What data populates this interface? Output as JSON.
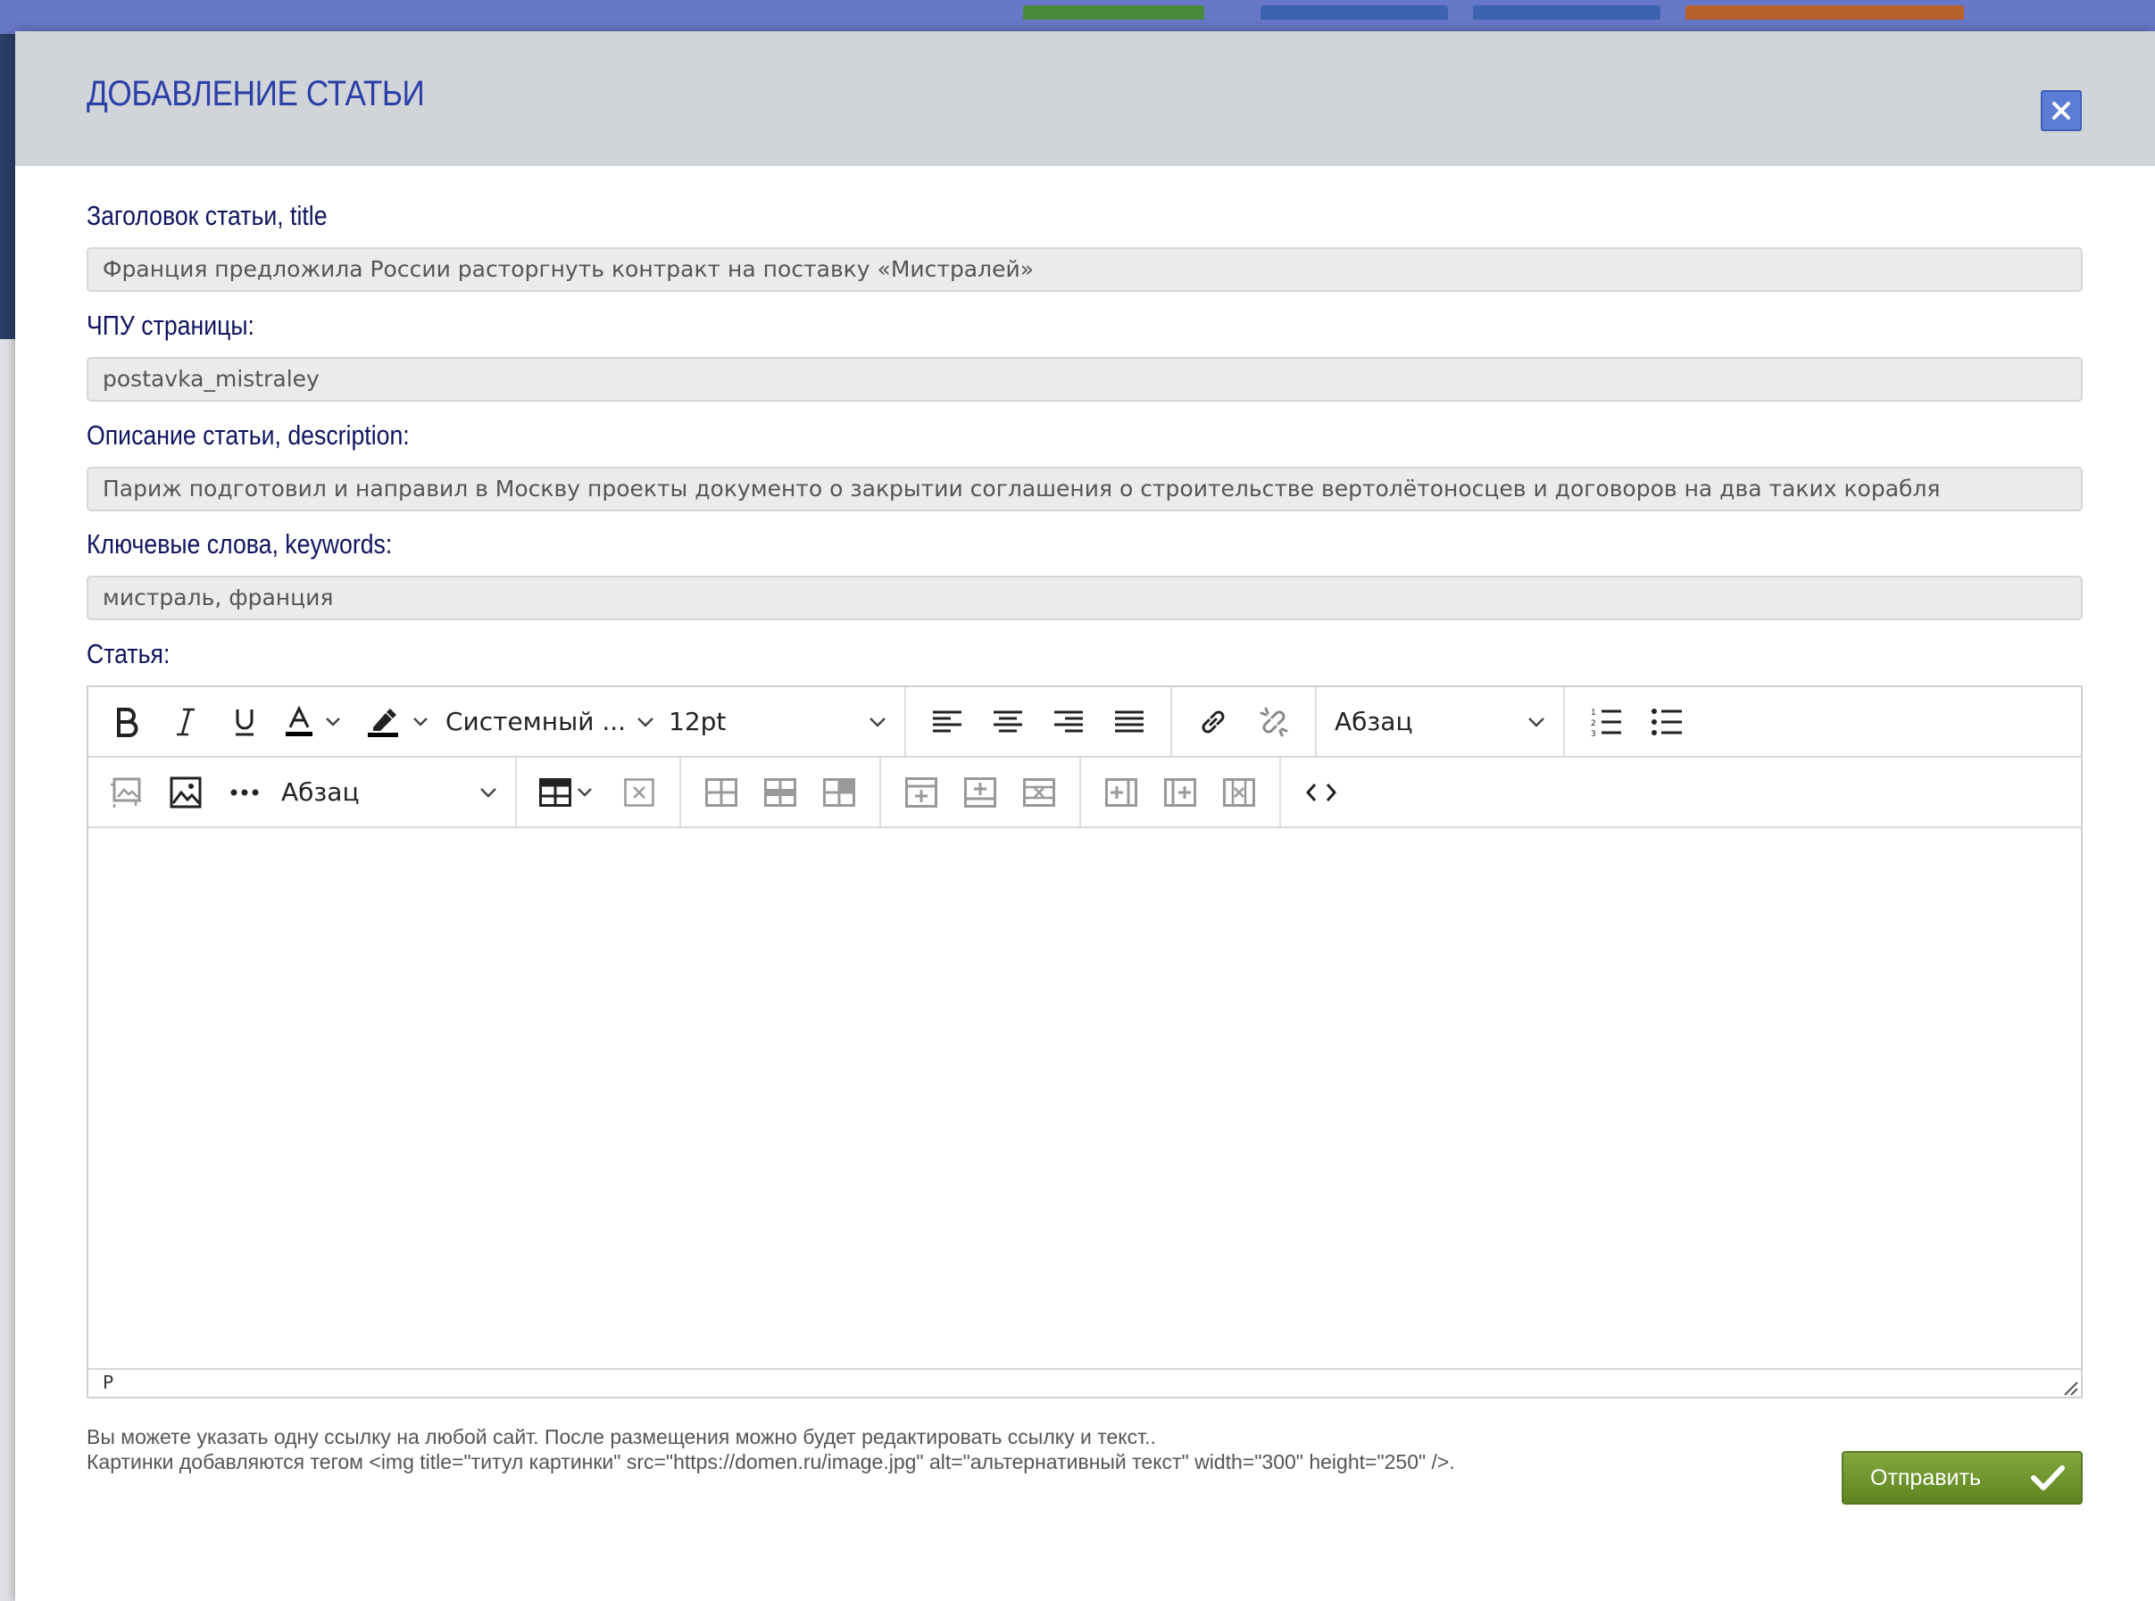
{
  "modal": {
    "title": "ДОБАВЛЕНИЕ СТАТЬИ"
  },
  "form": {
    "title_label": "Заголовок статьи, title",
    "title_value": "Франция предложила России расторгнуть контракт на поставку «Мистралей»",
    "slug_label": "ЧПУ страницы:",
    "slug_value": "postavka_mistraley",
    "description_label": "Описание статьи, description:",
    "description_value": "Париж подготовил и направил в Москву проекты документо о закрытии соглашения о строительстве вертолётоносцев и договоров на два таких корабля",
    "keywords_label": "Ключевые слова, keywords:",
    "keywords_value": "мистраль, франция",
    "article_label": "Статья:"
  },
  "editor": {
    "font_family": "Системный ...",
    "font_size": "12pt",
    "block_format_1": "Абзац",
    "block_format_2": "Абзац",
    "status_path": "P",
    "icons": {
      "bold": "bold-icon",
      "italic": "italic-icon",
      "underline": "underline-icon",
      "text_color": "text-color-icon",
      "highlight": "highlight-icon",
      "align_left": "align-left-icon",
      "align_center": "align-center-icon",
      "align_right": "align-right-icon",
      "justify": "justify-icon",
      "link": "link-icon",
      "unlink": "unlink-icon",
      "ordered_list": "ordered-list-icon",
      "bullet_list": "bullet-list-icon",
      "image_edit": "image-edit-icon",
      "image": "image-icon",
      "more": "more-icon",
      "table": "table-icon",
      "delete_table": "delete-table-icon",
      "code": "code-icon"
    },
    "text_color_accent": "#000000"
  },
  "footer": {
    "note_line_1": "Вы можете указать одну ссылку на любой сайт. После размещения можно будет редактировать ссылку и текст..",
    "note_line_2": "Картинки добавляются тегом <img title=\"титул картинки\" src=\"https://domen.ru/image.jpg\" alt=\"альтернативный текст\" width=\"300\" height=\"250\" />.",
    "submit_label": "Отправить"
  },
  "colors": {
    "title": "#2b3fa8",
    "label": "#101560",
    "close_button": "#5c7dd6",
    "submit_button": "#6f9630"
  }
}
